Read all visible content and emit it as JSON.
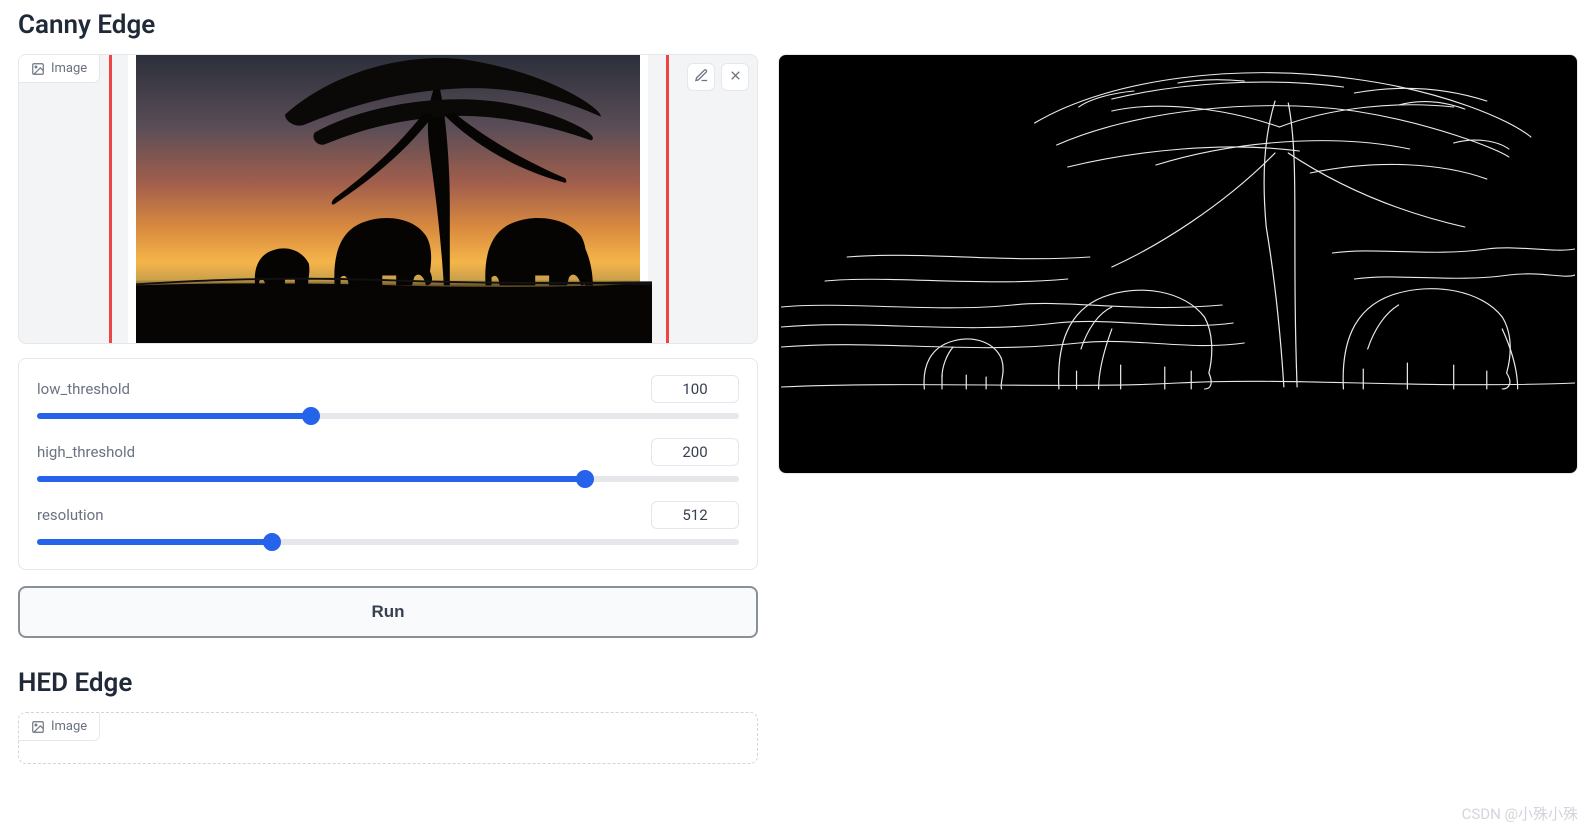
{
  "canny": {
    "title": "Canny Edge",
    "image_label": "Image",
    "icons": {
      "edit": "edit-icon",
      "close": "close-icon",
      "image": "image-icon"
    },
    "sliders": [
      {
        "name": "low_threshold",
        "label": "low_threshold",
        "value": 100,
        "min": 0,
        "max": 255,
        "fill_pct": 39
      },
      {
        "name": "high_threshold",
        "label": "high_threshold",
        "value": 200,
        "min": 0,
        "max": 255,
        "fill_pct": 78
      },
      {
        "name": "resolution",
        "label": "resolution",
        "value": 512,
        "min": 0,
        "max": 1536,
        "fill_pct": 33.5
      }
    ],
    "run_label": "Run"
  },
  "hed": {
    "title": "HED Edge",
    "image_label": "Image"
  },
  "watermark": "CSDN @小殊小殊"
}
